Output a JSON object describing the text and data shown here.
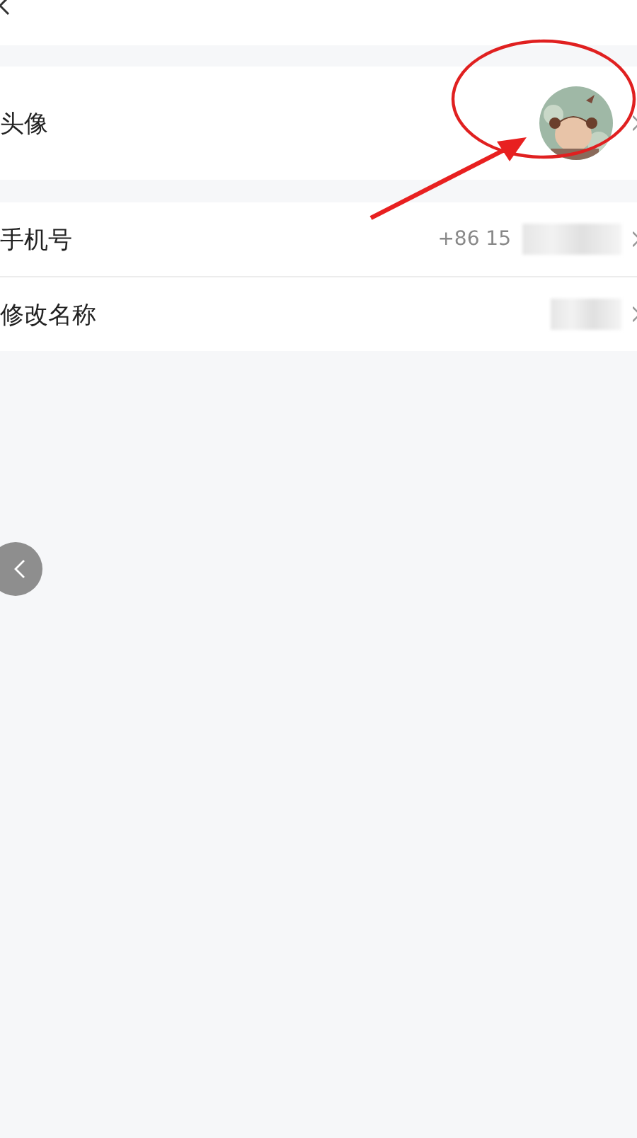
{
  "rows": [
    {
      "kind": "avatar",
      "label": "头像"
    },
    {
      "kind": "text",
      "label": "手机号",
      "value": "+86 15",
      "redacted": true
    },
    {
      "kind": "text",
      "label": "修改名称",
      "redacted": true
    }
  ]
}
